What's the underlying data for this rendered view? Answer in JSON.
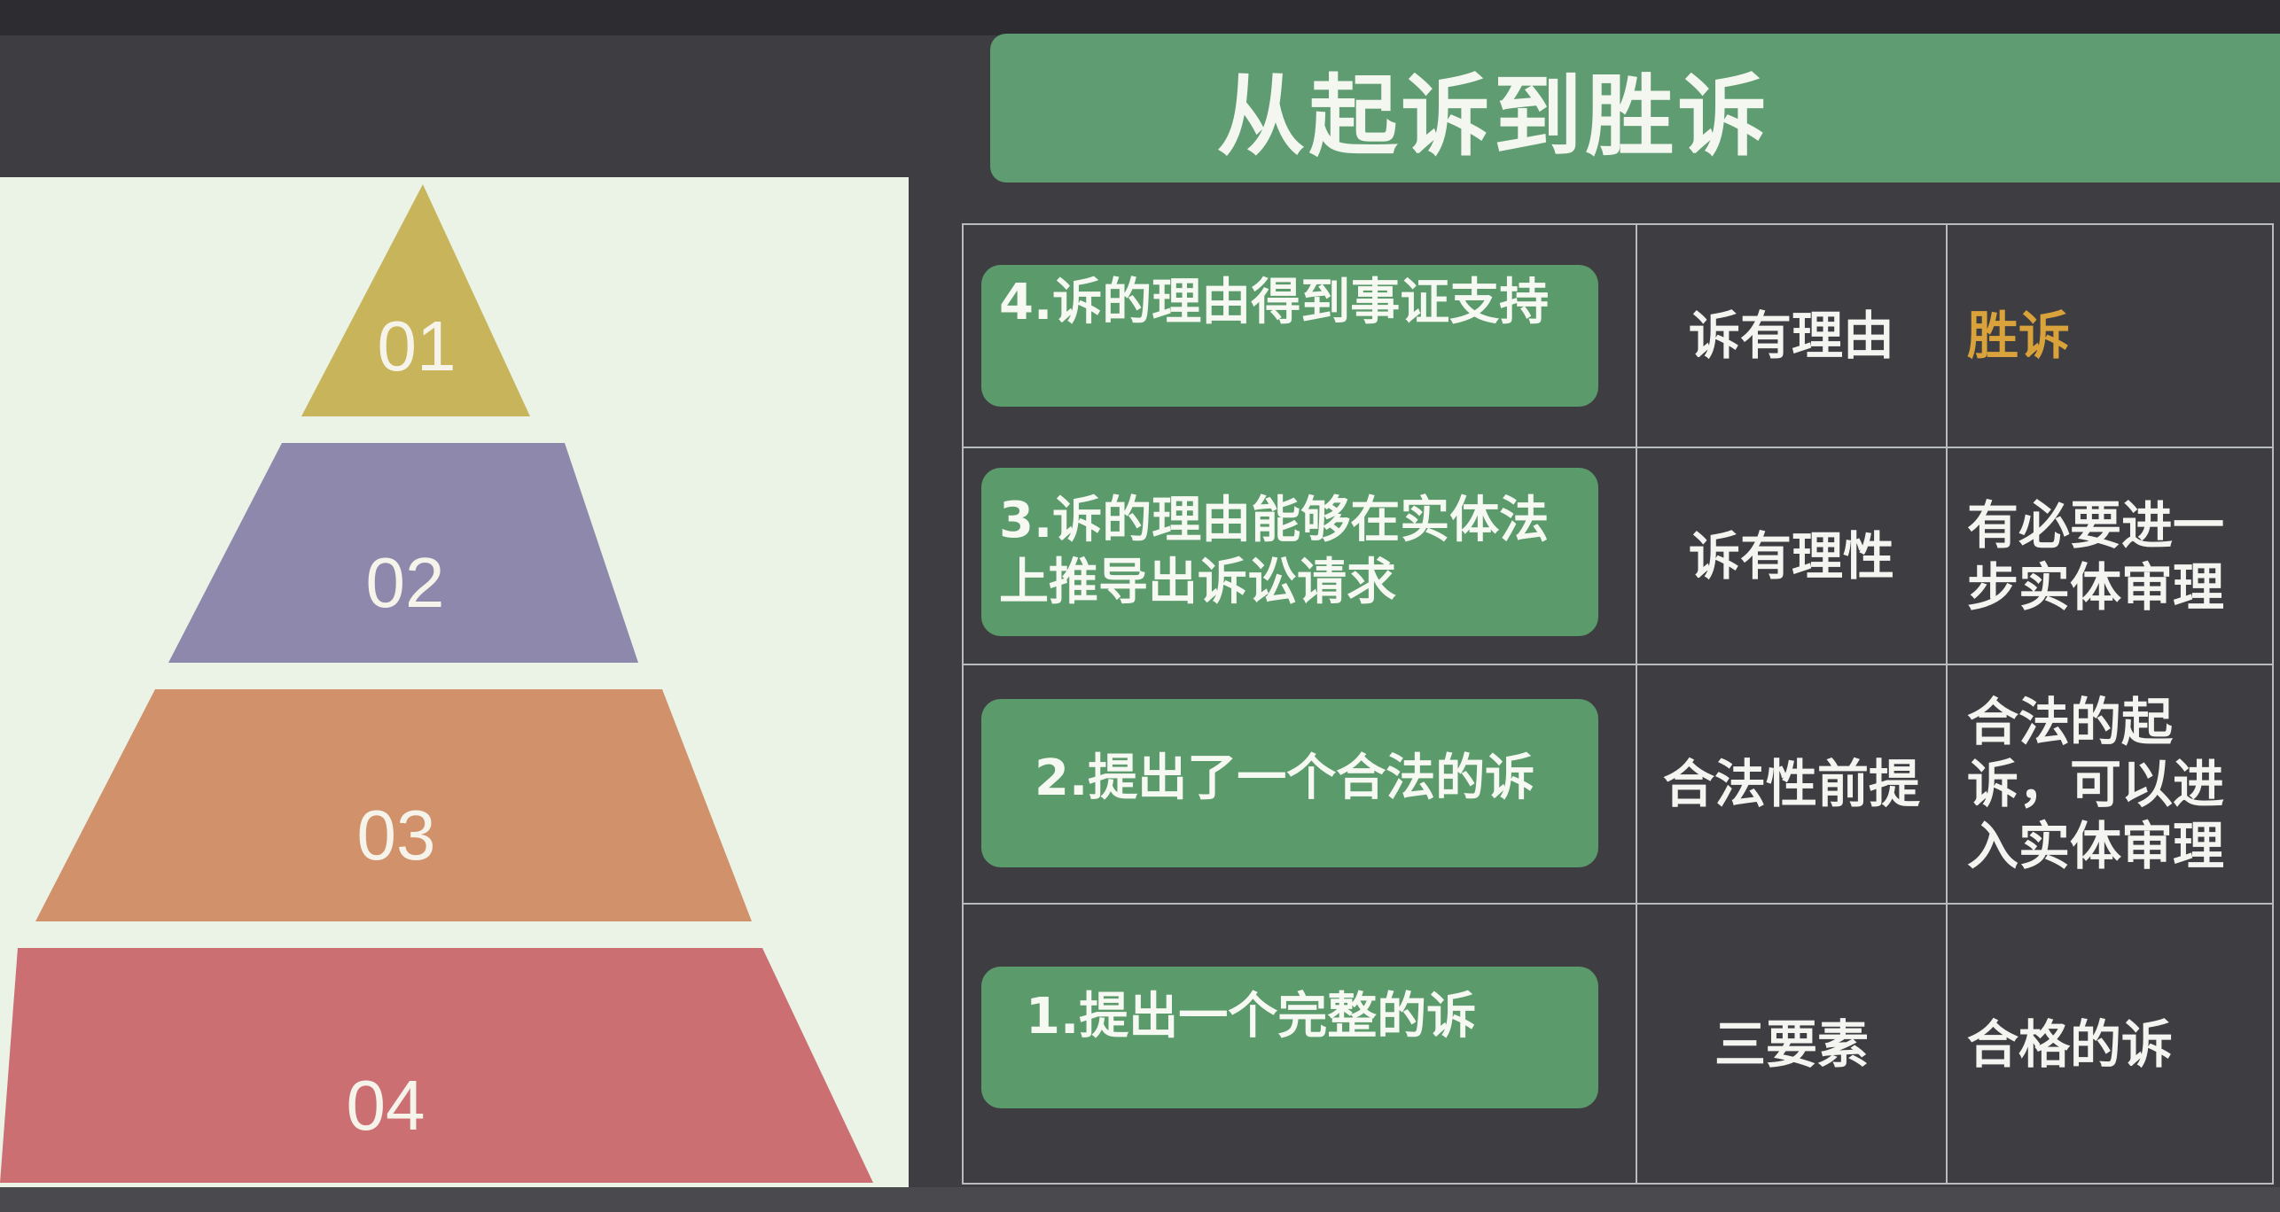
{
  "title": "从起诉到胜诉",
  "pyramid": [
    {
      "label": "01",
      "color": "#c8b45a"
    },
    {
      "label": "02",
      "color": "#8f88ad"
    },
    {
      "label": "03",
      "color": "#d0916b"
    },
    {
      "label": "04",
      "color": "#cc6f73"
    }
  ],
  "rows": [
    {
      "step": "4.诉的理由得到事证支持",
      "condition": "诉有理由",
      "result": "胜诉",
      "result_color": "#d9a23a"
    },
    {
      "step": "3.诉的理由能够在实体法上推导出诉讼请求",
      "condition": "诉有理性",
      "result": "有必要进一步实体审理"
    },
    {
      "step": "2.提出了一个合法的诉",
      "condition": "合法性前提",
      "result": "合法的起诉，可以进入实体审理"
    },
    {
      "step": "1.提出一个完整的诉",
      "condition": "三要素",
      "result": "合格的诉"
    }
  ]
}
